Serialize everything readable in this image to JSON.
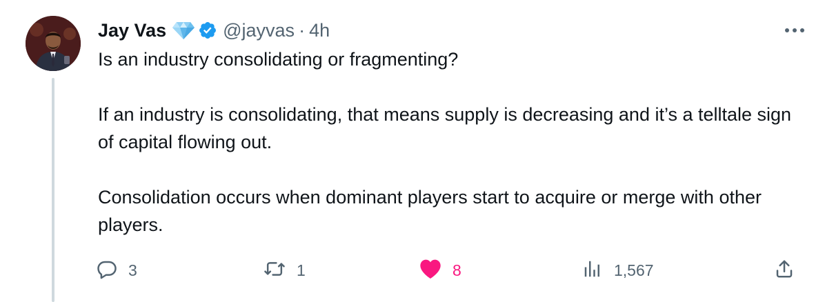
{
  "tweet": {
    "author_name": "Jay Vas",
    "handle": "@jayvas",
    "separator": "·",
    "time": "4h",
    "paragraphs": [
      "Is an industry consolidating or fragmenting?",
      "If an industry is consolidating, that means supply is decreasing and it’s a telltale sign of capital flowing out.",
      "Consolidation occurs when dominant players start to acquire or merge with other players."
    ],
    "actions": {
      "replies": "3",
      "retweets": "1",
      "likes": "8",
      "views": "1,567"
    },
    "icons": {
      "badge": "gem-icon",
      "verified": "verified-badge-icon",
      "more": "more-horizontal-icon",
      "reply": "reply-icon",
      "retweet": "retweet-icon",
      "like": "heart-icon",
      "views": "views-icon",
      "share": "share-icon"
    },
    "colors": {
      "text": "#0f1419",
      "secondary": "#536471",
      "verified": "#1d9bf0",
      "like": "#f91880",
      "thread_line": "#cfd9de"
    }
  }
}
